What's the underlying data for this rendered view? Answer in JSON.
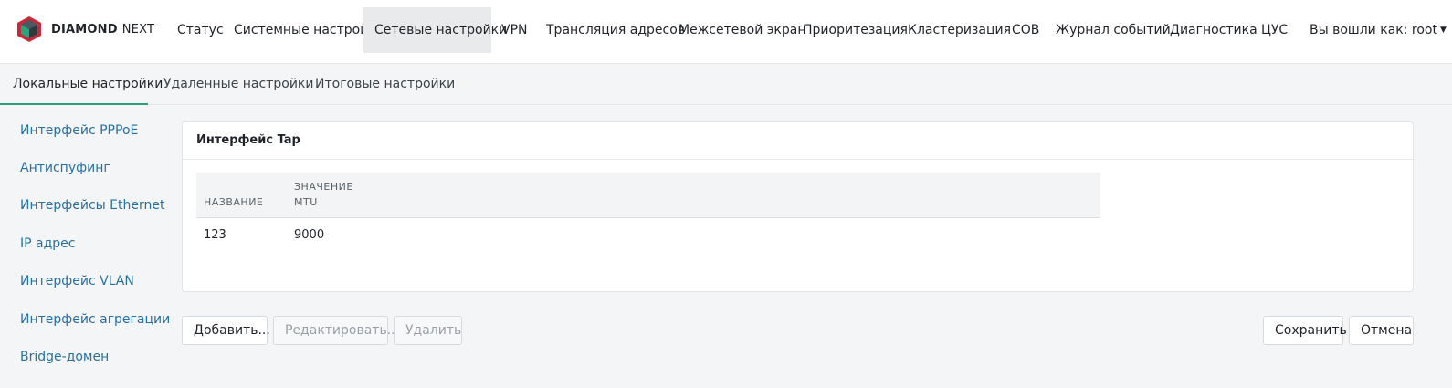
{
  "brand": {
    "name_bold": "DIAMOND",
    "name_light": "NEXT",
    "logo_icon": "diamond-logo-icon"
  },
  "nav": {
    "items": [
      {
        "label": "Статус"
      },
      {
        "label": "Системные настройки"
      },
      {
        "label": "Сетевые настройки",
        "active": true
      },
      {
        "label": "VPN"
      },
      {
        "label": "Трансляция адресов"
      },
      {
        "label": "Межсетевой экран"
      },
      {
        "label": "Приоритезация"
      },
      {
        "label": "Кластеризация"
      },
      {
        "label": "СОВ"
      },
      {
        "label": "Журнал событий"
      },
      {
        "label": "Диагностика"
      },
      {
        "label": "ЦУС"
      }
    ],
    "user_label": "Вы вошли как: root",
    "user_caret_icon": "caret-down-icon"
  },
  "subtabs": [
    {
      "label": "Локальные настройки",
      "active": true
    },
    {
      "label": "Удаленные настройки"
    },
    {
      "label": "Итоговые настройки"
    }
  ],
  "sidebar": {
    "items": [
      {
        "label": "Интерфейс PPPoE"
      },
      {
        "label": "Антиспуфинг"
      },
      {
        "label": "Интерфейсы Ethernet"
      },
      {
        "label": "IP адрес"
      },
      {
        "label": "Интерфейс VLAN"
      },
      {
        "label": "Интерфейс агрегации"
      },
      {
        "label": "Bridge-домен"
      }
    ]
  },
  "panel": {
    "title": "Интерфейс Tap",
    "columns": {
      "name": "НАЗВАНИЕ",
      "value_line1": "ЗНАЧЕНИЕ",
      "value_line2": "MTU"
    },
    "rows": [
      {
        "name": "123",
        "mtu": "9000"
      }
    ]
  },
  "actions": {
    "add": "Добавить...",
    "edit": "Редактировать...",
    "delete": "Удалить",
    "save": "Сохранить",
    "cancel": "Отмена"
  },
  "colors": {
    "accent": "#2e9e78",
    "link": "#2a6fa1",
    "logo_red": "#c62a3a",
    "logo_dark": "#2f3a40"
  }
}
